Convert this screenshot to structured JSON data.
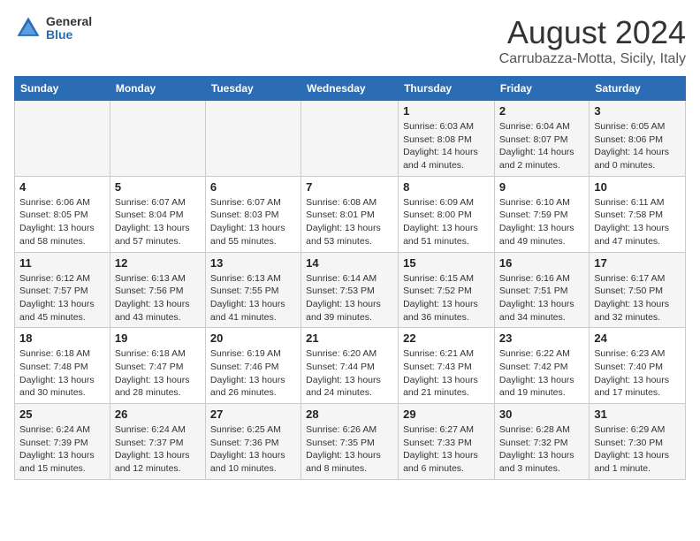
{
  "header": {
    "logo_general": "General",
    "logo_blue": "Blue",
    "month_year": "August 2024",
    "location": "Carrubazza-Motta, Sicily, Italy"
  },
  "calendar": {
    "weekdays": [
      "Sunday",
      "Monday",
      "Tuesday",
      "Wednesday",
      "Thursday",
      "Friday",
      "Saturday"
    ],
    "weeks": [
      [
        {
          "day": "",
          "info": ""
        },
        {
          "day": "",
          "info": ""
        },
        {
          "day": "",
          "info": ""
        },
        {
          "day": "",
          "info": ""
        },
        {
          "day": "1",
          "info": "Sunrise: 6:03 AM\nSunset: 8:08 PM\nDaylight: 14 hours\nand 4 minutes."
        },
        {
          "day": "2",
          "info": "Sunrise: 6:04 AM\nSunset: 8:07 PM\nDaylight: 14 hours\nand 2 minutes."
        },
        {
          "day": "3",
          "info": "Sunrise: 6:05 AM\nSunset: 8:06 PM\nDaylight: 14 hours\nand 0 minutes."
        }
      ],
      [
        {
          "day": "4",
          "info": "Sunrise: 6:06 AM\nSunset: 8:05 PM\nDaylight: 13 hours\nand 58 minutes."
        },
        {
          "day": "5",
          "info": "Sunrise: 6:07 AM\nSunset: 8:04 PM\nDaylight: 13 hours\nand 57 minutes."
        },
        {
          "day": "6",
          "info": "Sunrise: 6:07 AM\nSunset: 8:03 PM\nDaylight: 13 hours\nand 55 minutes."
        },
        {
          "day": "7",
          "info": "Sunrise: 6:08 AM\nSunset: 8:01 PM\nDaylight: 13 hours\nand 53 minutes."
        },
        {
          "day": "8",
          "info": "Sunrise: 6:09 AM\nSunset: 8:00 PM\nDaylight: 13 hours\nand 51 minutes."
        },
        {
          "day": "9",
          "info": "Sunrise: 6:10 AM\nSunset: 7:59 PM\nDaylight: 13 hours\nand 49 minutes."
        },
        {
          "day": "10",
          "info": "Sunrise: 6:11 AM\nSunset: 7:58 PM\nDaylight: 13 hours\nand 47 minutes."
        }
      ],
      [
        {
          "day": "11",
          "info": "Sunrise: 6:12 AM\nSunset: 7:57 PM\nDaylight: 13 hours\nand 45 minutes."
        },
        {
          "day": "12",
          "info": "Sunrise: 6:13 AM\nSunset: 7:56 PM\nDaylight: 13 hours\nand 43 minutes."
        },
        {
          "day": "13",
          "info": "Sunrise: 6:13 AM\nSunset: 7:55 PM\nDaylight: 13 hours\nand 41 minutes."
        },
        {
          "day": "14",
          "info": "Sunrise: 6:14 AM\nSunset: 7:53 PM\nDaylight: 13 hours\nand 39 minutes."
        },
        {
          "day": "15",
          "info": "Sunrise: 6:15 AM\nSunset: 7:52 PM\nDaylight: 13 hours\nand 36 minutes."
        },
        {
          "day": "16",
          "info": "Sunrise: 6:16 AM\nSunset: 7:51 PM\nDaylight: 13 hours\nand 34 minutes."
        },
        {
          "day": "17",
          "info": "Sunrise: 6:17 AM\nSunset: 7:50 PM\nDaylight: 13 hours\nand 32 minutes."
        }
      ],
      [
        {
          "day": "18",
          "info": "Sunrise: 6:18 AM\nSunset: 7:48 PM\nDaylight: 13 hours\nand 30 minutes."
        },
        {
          "day": "19",
          "info": "Sunrise: 6:18 AM\nSunset: 7:47 PM\nDaylight: 13 hours\nand 28 minutes."
        },
        {
          "day": "20",
          "info": "Sunrise: 6:19 AM\nSunset: 7:46 PM\nDaylight: 13 hours\nand 26 minutes."
        },
        {
          "day": "21",
          "info": "Sunrise: 6:20 AM\nSunset: 7:44 PM\nDaylight: 13 hours\nand 24 minutes."
        },
        {
          "day": "22",
          "info": "Sunrise: 6:21 AM\nSunset: 7:43 PM\nDaylight: 13 hours\nand 21 minutes."
        },
        {
          "day": "23",
          "info": "Sunrise: 6:22 AM\nSunset: 7:42 PM\nDaylight: 13 hours\nand 19 minutes."
        },
        {
          "day": "24",
          "info": "Sunrise: 6:23 AM\nSunset: 7:40 PM\nDaylight: 13 hours\nand 17 minutes."
        }
      ],
      [
        {
          "day": "25",
          "info": "Sunrise: 6:24 AM\nSunset: 7:39 PM\nDaylight: 13 hours\nand 15 minutes."
        },
        {
          "day": "26",
          "info": "Sunrise: 6:24 AM\nSunset: 7:37 PM\nDaylight: 13 hours\nand 12 minutes."
        },
        {
          "day": "27",
          "info": "Sunrise: 6:25 AM\nSunset: 7:36 PM\nDaylight: 13 hours\nand 10 minutes."
        },
        {
          "day": "28",
          "info": "Sunrise: 6:26 AM\nSunset: 7:35 PM\nDaylight: 13 hours\nand 8 minutes."
        },
        {
          "day": "29",
          "info": "Sunrise: 6:27 AM\nSunset: 7:33 PM\nDaylight: 13 hours\nand 6 minutes."
        },
        {
          "day": "30",
          "info": "Sunrise: 6:28 AM\nSunset: 7:32 PM\nDaylight: 13 hours\nand 3 minutes."
        },
        {
          "day": "31",
          "info": "Sunrise: 6:29 AM\nSunset: 7:30 PM\nDaylight: 13 hours\nand 1 minute."
        }
      ]
    ]
  }
}
